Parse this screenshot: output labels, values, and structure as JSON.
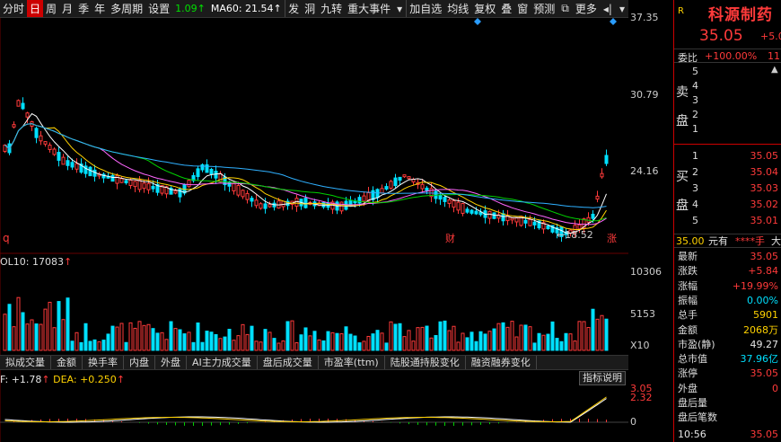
{
  "toolbar": {
    "left_items": [
      "分时",
      "日",
      "周",
      "月",
      "季",
      "年",
      "多周期",
      "设置"
    ],
    "active_index": 1,
    "ma_values": [
      {
        "text": "1.09↑",
        "color": "#00e000"
      },
      {
        "text": "MA60: 21.54↑",
        "color": "#ffffff"
      }
    ],
    "right_items": [
      "发",
      "洞",
      "九转",
      "重大事件",
      "加自选",
      "均线",
      "复权",
      "叠",
      "窗",
      "预测",
      "更多"
    ],
    "dropdown_icon": "triangle-down",
    "nav_icon": "arrow-right-bar"
  },
  "price_axis": [
    "37.35",
    "30.79",
    "24.16"
  ],
  "chart_annotations": {
    "low_label": "←18.52",
    "left_marker": "q",
    "event_marker": "财",
    "limit_marker": "涨"
  },
  "volume": {
    "header_prefix": "OL10: ",
    "header_value": "17083",
    "header_arrow": "↑",
    "axis": [
      "10306",
      "5153",
      "X10"
    ]
  },
  "indicator_tabs": [
    "拟成交量",
    "金额",
    "换手率",
    "内盘",
    "外盘",
    "AI主力成交量",
    "盘后成交量",
    "市盈率(ttm)",
    "陆股通持股变化",
    "融资融券变化"
  ],
  "macd": {
    "dif_label": "F: ",
    "dif_value": "+1.78",
    "dif_arrow": "↑",
    "dea_label": "DEA: ",
    "dea_value": "+0.250",
    "dea_arrow": "↑",
    "axis": [
      "3.05",
      "2.32",
      "0"
    ],
    "desc_button": "指标说明"
  },
  "quote": {
    "r_badge": "R",
    "name": "科源制药",
    "price": "35.05",
    "change_short": "+5.0",
    "weibi_label": "委比",
    "weibi_value": "+100.00%",
    "weibi_extra": "11",
    "sell_side": "卖盘",
    "buy_side": "买盘",
    "sell_levels": [
      "5",
      "4",
      "3",
      "2",
      "1"
    ],
    "buy_levels": [
      {
        "lvl": "1",
        "price": "35.05"
      },
      {
        "lvl": "2",
        "price": "35.04"
      },
      {
        "lvl": "3",
        "price": "35.03"
      },
      {
        "lvl": "4",
        "price": "35.02"
      },
      {
        "lvl": "5",
        "price": "35.01"
      }
    ],
    "inline_price": "35.00",
    "inline_unit": "元有",
    "inline_hand": "****手",
    "inline_big": "大",
    "stats": [
      {
        "label": "最新",
        "value": "35.05",
        "color": "#ff3a3a"
      },
      {
        "label": "涨跌",
        "value": "+5.84",
        "color": "#ff3a3a"
      },
      {
        "label": "涨幅",
        "value": "+19.99%",
        "color": "#ff3a3a"
      },
      {
        "label": "振幅",
        "value": "0.00%",
        "color": "#00e0ff"
      },
      {
        "label": "总手",
        "value": "5901",
        "color": "#ffd200"
      },
      {
        "label": "金额",
        "value": "2068万",
        "color": "#ffd200"
      },
      {
        "label": "市盈(静)",
        "value": "49.27",
        "color": "#e6e6e6"
      },
      {
        "label": "总市值",
        "value": "37.96亿",
        "color": "#00e0ff"
      },
      {
        "label": "涨停",
        "value": "35.05",
        "color": "#ff3a3a"
      },
      {
        "label": "外盘",
        "value": "0",
        "color": "#ff3a3a"
      },
      {
        "label": "盘后量",
        "value": "",
        "color": "#e6e6e6"
      },
      {
        "label": "盘后笔数",
        "value": "",
        "color": "#e6e6e6"
      }
    ],
    "time": "10:56",
    "time_price": "35.05"
  },
  "colors": {
    "up": "#ff3a3a",
    "down": "#00e0ff",
    "accent": "#c00000"
  }
}
